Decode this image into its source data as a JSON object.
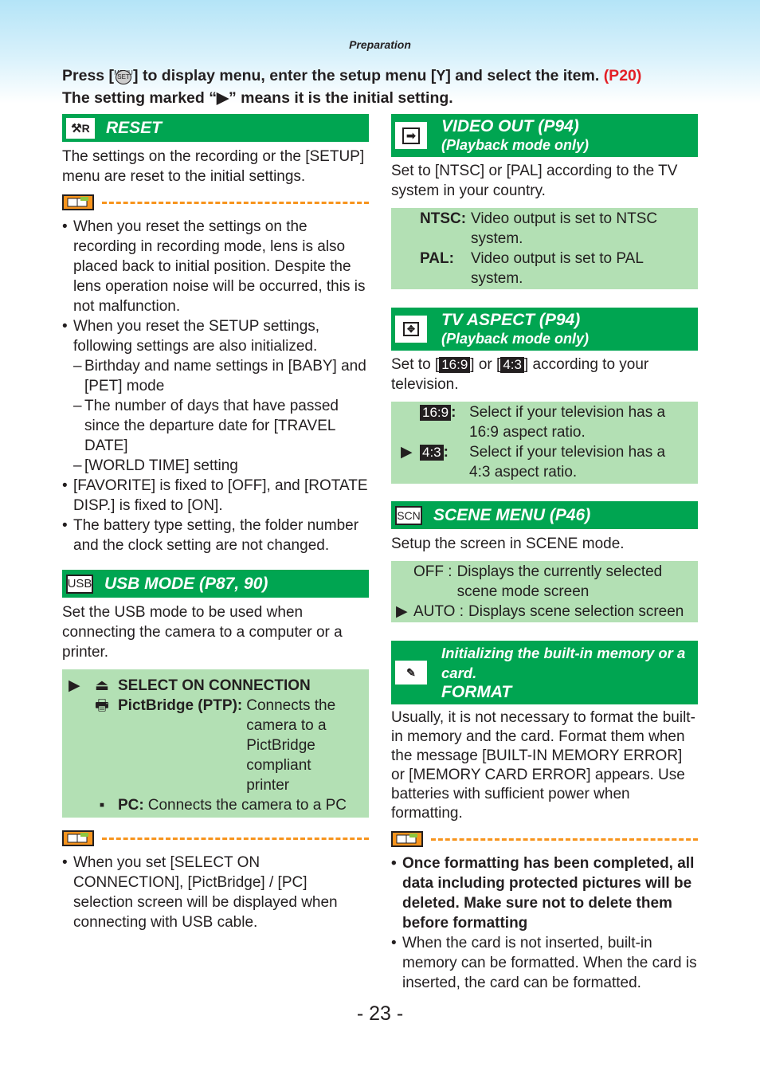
{
  "page": {
    "section": "Preparation",
    "intro_line1_a": "Press [",
    "intro_menu_top": "MENU",
    "intro_menu_circle": "SET",
    "intro_line1_b": "] to display menu, enter the setup menu [",
    "intro_wrench": "Y",
    "intro_line1_c": "] and select the item.",
    "intro_ref": "(P20)",
    "intro_line2": "The setting marked “▶” means it is the initial setting.",
    "page_number": "- 23 -",
    "colors": {
      "header_green": "#00a551",
      "box_green": "#b3e0b4",
      "note_orange": "#f7941d",
      "ref_red": "#e31f26"
    }
  },
  "reset": {
    "icon": "reset-icon",
    "icon_text": "R",
    "title": "RESET",
    "desc": "The settings on the recording or the [SETUP] menu are reset to the initial settings.",
    "notes": [
      "When you reset the settings on the recording in recording mode, lens is also placed back to initial position. Despite the lens operation noise will be occurred, this is not malfunction.",
      "When you reset the SETUP settings, following settings are also initialized."
    ],
    "sub_items": [
      "Birthday and name settings in [BABY] and [PET] mode",
      "The number of days that have passed since the departure date for [TRAVEL DATE]",
      "[WORLD TIME] setting"
    ],
    "notes2": [
      "[FAVORITE] is fixed to [OFF], and [ROTATE DISP.] is fixed to [ON].",
      "The battery type setting, the folder number and the clock setting are not changed."
    ]
  },
  "usb": {
    "icon_text": "USB",
    "title": "USB MODE (P87, 90)",
    "desc": "Set the USB mode to be used when connecting the camera to a computer or a printer.",
    "options": [
      {
        "label": "SELECT ON CONNECTION",
        "desc": "",
        "initial": true
      },
      {
        "label": "PictBridge (PTP):",
        "desc": "Connects the camera to a PictBridge compliant printer",
        "initial": false
      },
      {
        "label": "PC:",
        "desc": "Connects the camera to a PC",
        "initial": false
      }
    ],
    "note": "When you set [SELECT ON CONNECTION], [PictBridge] / [PC] selection screen will be displayed when connecting with USB cable."
  },
  "video_out": {
    "title": "VIDEO OUT (P94)",
    "subtitle": "(Playback mode only)",
    "desc": "Set to [NTSC] or [PAL] according to the TV system in your country.",
    "options": [
      {
        "label": "NTSC:",
        "desc": "Video output is set to NTSC system."
      },
      {
        "label": "PAL:",
        "desc": "Video output is set to PAL system."
      }
    ]
  },
  "tv_aspect": {
    "title": "TV ASPECT (P94)",
    "subtitle": "(Playback mode only)",
    "desc_a": "Set to [",
    "desc_b": "] or [",
    "desc_c": "] according to your television.",
    "ratio_169": "16:9",
    "ratio_43": "4:3",
    "options": [
      {
        "label": "16:9",
        "desc": "Select if your television has a 16:9 aspect ratio.",
        "initial": false
      },
      {
        "label": "4:3",
        "desc": "Select if your television has a 4:3 aspect ratio.",
        "initial": true
      }
    ]
  },
  "scene_menu": {
    "icon_text": "SCN",
    "title": "SCENE MENU (P46)",
    "desc": "Setup the screen in SCENE mode.",
    "options": [
      {
        "label": "OFF :",
        "desc": "Displays the currently selected scene mode screen",
        "initial": false
      },
      {
        "label": "AUTO :",
        "desc": "Displays scene selection screen",
        "initial": true
      }
    ]
  },
  "format": {
    "subtitle": "Initializing the built-in memory or a card.",
    "title": "FORMAT",
    "desc": "Usually, it is not necessary to format the built-in memory and the card. Format them when the message [BUILT-IN MEMORY ERROR] or [MEMORY CARD ERROR] appears. Use batteries with sufficient power when formatting.",
    "note_bold": "Once formatting has been completed, all data including protected pictures will be deleted. Make sure not to delete them before formatting",
    "note": "When the card is not inserted, built-in memory can be formatted. When the card is inserted, the card can be formatted."
  }
}
